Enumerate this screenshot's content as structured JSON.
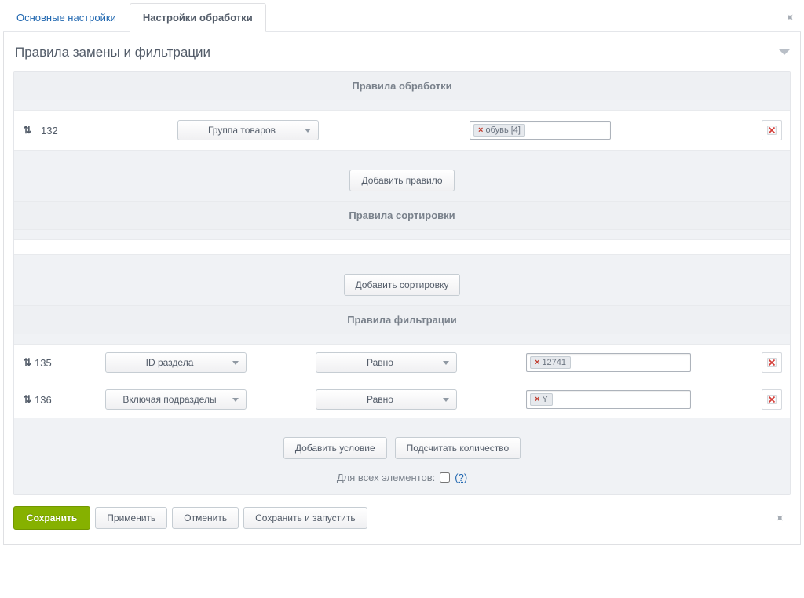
{
  "tabs": {
    "main": "Основные настройки",
    "processing": "Настройки обработки"
  },
  "panel": {
    "title": "Правила замены и фильтрации"
  },
  "sections": {
    "rules": "Правила обработки",
    "sorting": "Правила сортировки",
    "filter": "Правила фильтрации"
  },
  "processing_rule": {
    "id": "132",
    "select_label": "Группа товаров",
    "tag_value": "обувь [4]"
  },
  "filter_rows": [
    {
      "id": "135",
      "field": "ID раздела",
      "op": "Равно",
      "value": "12741"
    },
    {
      "id": "136",
      "field": "Включая подразделы",
      "op": "Равно",
      "value": "Y"
    }
  ],
  "buttons": {
    "add_rule": "Добавить правило",
    "add_sort": "Добавить сортировку",
    "add_condition": "Добавить условие",
    "count": "Подсчитать количество",
    "save": "Сохранить",
    "apply": "Применить",
    "cancel": "Отменить",
    "save_run": "Сохранить и запустить"
  },
  "checkbox": {
    "label": "Для всех элементов:",
    "help": "(?)"
  }
}
